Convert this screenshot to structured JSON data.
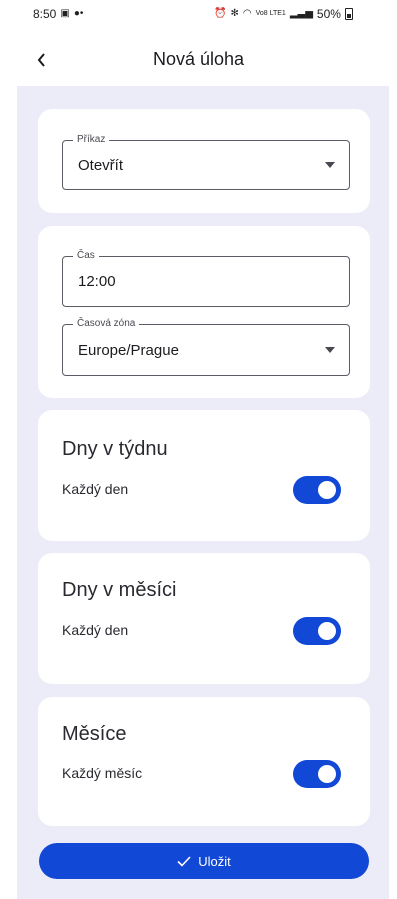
{
  "status_bar": {
    "time": "8:50",
    "battery": "50%",
    "network": "Vo8 LTE1"
  },
  "header": {
    "title": "Nová úloha",
    "back_icon": "chevron-left-icon"
  },
  "command": {
    "label": "Příkaz",
    "value": "Otevřít"
  },
  "time_card": {
    "time_label": "Čas",
    "time_value": "12:00",
    "timezone_label": "Časová zóna",
    "timezone_value": "Europe/Prague"
  },
  "weekdays": {
    "title": "Dny v týdnu",
    "subtitle": "Každý den",
    "enabled": true
  },
  "month_days": {
    "title": "Dny v měsíci",
    "subtitle": "Každý den",
    "enabled": true
  },
  "months": {
    "title": "Měsíce",
    "subtitle": "Každý měsíc",
    "enabled": true
  },
  "actions": {
    "save_label": "Uložit"
  },
  "colors": {
    "accent": "#1248d6",
    "background": "#ecebf8",
    "card": "#ffffff"
  }
}
